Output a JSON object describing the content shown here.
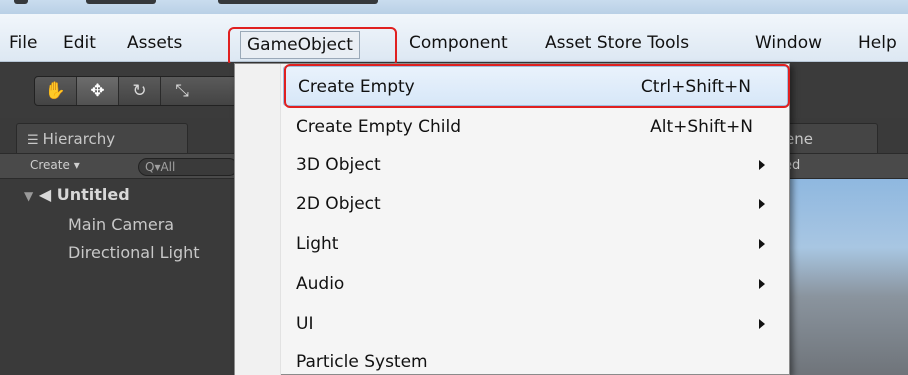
{
  "menubar": {
    "items": [
      {
        "label": "File"
      },
      {
        "label": "Edit"
      },
      {
        "label": "Assets"
      },
      {
        "label": "GameObject"
      },
      {
        "label": "Component"
      },
      {
        "label": "Asset Store Tools"
      },
      {
        "label": "Window"
      },
      {
        "label": "Help"
      }
    ],
    "active_item": "GameObject"
  },
  "toolbar": {
    "tools": [
      {
        "icon": "hand-icon",
        "glyph": "✋"
      },
      {
        "icon": "move-icon",
        "glyph": "✥"
      },
      {
        "icon": "rotate-icon",
        "glyph": "↻"
      },
      {
        "icon": "scale-icon",
        "glyph": "⤡"
      }
    ]
  },
  "hierarchy": {
    "tab_label": "Hierarchy",
    "create_label": "Create ▾",
    "search_placeholder": "Q▾All",
    "scene_name": "Untitled",
    "objects": [
      "Main Camera",
      "Directional Light"
    ]
  },
  "scene_view": {
    "tab_label": "ene",
    "bar_label": "ed"
  },
  "dropdown": {
    "items": [
      {
        "label": "Create Empty",
        "shortcut": "Ctrl+Shift+N",
        "submenu": false,
        "highlighted": true
      },
      {
        "label": "Create Empty Child",
        "shortcut": "Alt+Shift+N",
        "submenu": false
      },
      {
        "label": "3D Object",
        "shortcut": "",
        "submenu": true
      },
      {
        "label": "2D Object",
        "shortcut": "",
        "submenu": true
      },
      {
        "label": "Light",
        "shortcut": "",
        "submenu": true
      },
      {
        "label": "Audio",
        "shortcut": "",
        "submenu": true
      },
      {
        "label": "UI",
        "shortcut": "",
        "submenu": true
      },
      {
        "label": "Particle System",
        "shortcut": "",
        "submenu": false
      }
    ]
  },
  "colors": {
    "highlight_box": "#e02020",
    "menu_hover": "#d7e7f8",
    "editor_bg": "#383838"
  }
}
